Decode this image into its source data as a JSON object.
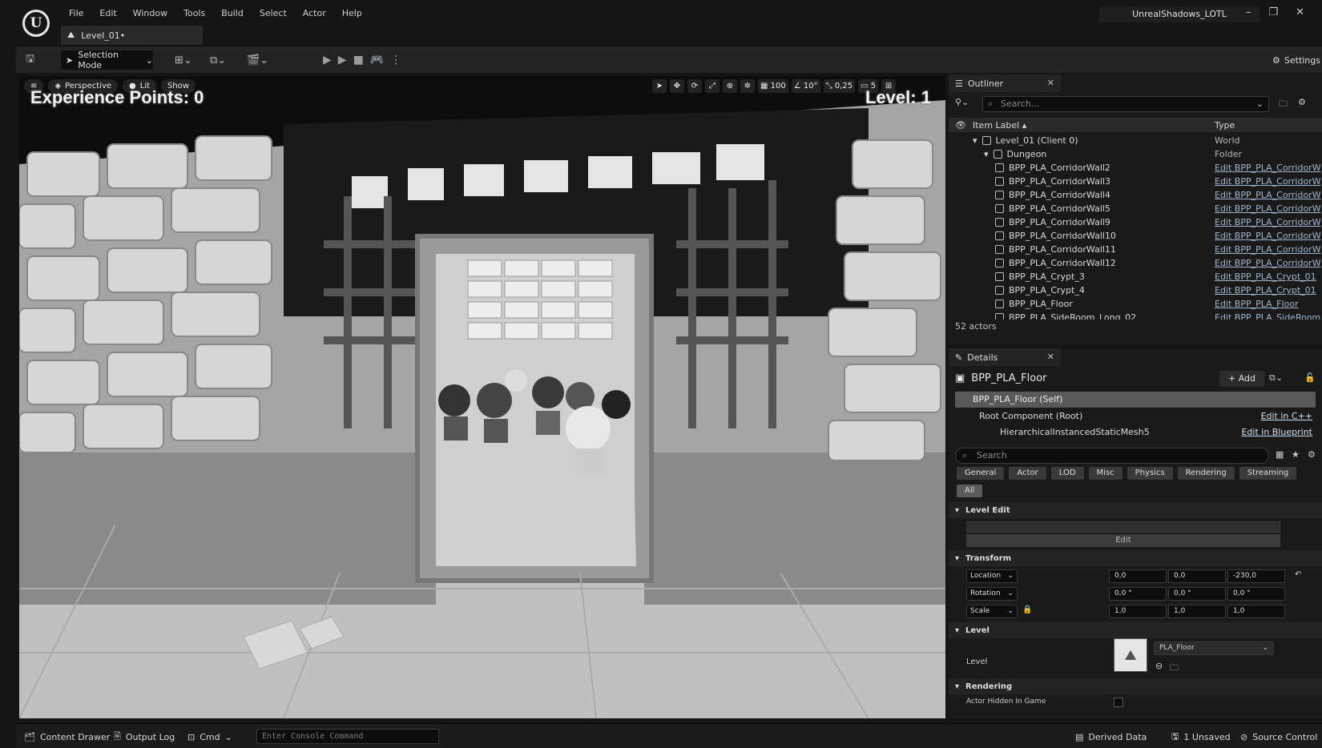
{
  "menu": [
    "File",
    "Edit",
    "Window",
    "Tools",
    "Build",
    "Select",
    "Actor",
    "Help"
  ],
  "tab": {
    "level": "Level_01•"
  },
  "project_name": "UnrealShadows_LOTL",
  "toolbar": {
    "selection_mode": "Selection Mode",
    "settings": "Settings"
  },
  "viewport": {
    "perspective": "Perspective",
    "lit": "Lit",
    "show": "Show",
    "grid_snap": "100",
    "rot_snap": "10°",
    "scale_snap": "0,25",
    "cam_speed": "5",
    "xp": "Experience Points: 0",
    "level": "Level: 1"
  },
  "outliner": {
    "title": "Outliner",
    "search_placeholder": "Search...",
    "col_label": "Item Label ▴",
    "col_type": "Type",
    "rows": [
      {
        "label": "Level_01 (Client 0)",
        "type": "World",
        "indent": 0,
        "link": false
      },
      {
        "label": "Dungeon",
        "type": "Folder",
        "indent": 1,
        "link": false
      },
      {
        "label": "BPP_PLA_CorridorWall2",
        "type": "Edit BPP_PLA_CorridorW",
        "indent": 2,
        "link": true
      },
      {
        "label": "BPP_PLA_CorridorWall3",
        "type": "Edit BPP_PLA_CorridorW",
        "indent": 2,
        "link": true
      },
      {
        "label": "BPP_PLA_CorridorWall4",
        "type": "Edit BPP_PLA_CorridorW",
        "indent": 2,
        "link": true
      },
      {
        "label": "BPP_PLA_CorridorWall5",
        "type": "Edit BPP_PLA_CorridorW",
        "indent": 2,
        "link": true
      },
      {
        "label": "BPP_PLA_CorridorWall9",
        "type": "Edit BPP_PLA_CorridorW",
        "indent": 2,
        "link": true
      },
      {
        "label": "BPP_PLA_CorridorWall10",
        "type": "Edit BPP_PLA_CorridorW",
        "indent": 2,
        "link": true
      },
      {
        "label": "BPP_PLA_CorridorWall11",
        "type": "Edit BPP_PLA_CorridorW",
        "indent": 2,
        "link": true
      },
      {
        "label": "BPP_PLA_CorridorWall12",
        "type": "Edit BPP_PLA_CorridorW",
        "indent": 2,
        "link": true
      },
      {
        "label": "BPP_PLA_Crypt_3",
        "type": "Edit BPP_PLA_Crypt_01",
        "indent": 2,
        "link": true
      },
      {
        "label": "BPP_PLA_Crypt_4",
        "type": "Edit BPP_PLA_Crypt_01",
        "indent": 2,
        "link": true
      },
      {
        "label": "BPP_PLA_Floor",
        "type": "Edit BPP_PLA_Floor",
        "indent": 2,
        "link": true
      },
      {
        "label": "BPP_PLA_SideRoom_Long_02",
        "type": "Edit BPP_PLA_SideRoom",
        "indent": 2,
        "link": true
      }
    ],
    "count": "52 actors"
  },
  "details": {
    "title": "Details",
    "actor": "BPP_PLA_Floor",
    "add": "+ Add",
    "self": "BPP_PLA_Floor (Self)",
    "root": "Root Component (Root)",
    "root_link": "Edit in C++",
    "mesh": "HierarchicalInstancedStaticMesh5",
    "mesh_link": "Edit in Blueprint",
    "search_placeholder": "Search",
    "filters": [
      "General",
      "Actor",
      "LOD",
      "Misc",
      "Physics",
      "Rendering",
      "Streaming",
      "All"
    ],
    "sections": {
      "level_edit": "Level Edit",
      "transform": "Transform",
      "level": "Level",
      "rendering": "Rendering"
    },
    "edit_btn": "Edit",
    "location": {
      "label": "Location",
      "x": "0,0",
      "y": "0,0",
      "z": "-230,0"
    },
    "rotation": {
      "label": "Rotation",
      "x": "0,0 °",
      "y": "0,0 °",
      "z": "0,0 °"
    },
    "scale": {
      "label": "Scale",
      "x": "1,0",
      "y": "1,0",
      "z": "1,0"
    },
    "level_label": "Level",
    "level_value": "PLA_Floor",
    "hidden_label": "Actor Hidden In Game"
  },
  "statusbar": {
    "content_drawer": "Content Drawer",
    "output_log": "Output Log",
    "cmd": "Cmd",
    "console_placeholder": "Enter Console Command",
    "derived_data": "Derived Data",
    "unsaved": "1 Unsaved",
    "source_control": "Source Control"
  }
}
